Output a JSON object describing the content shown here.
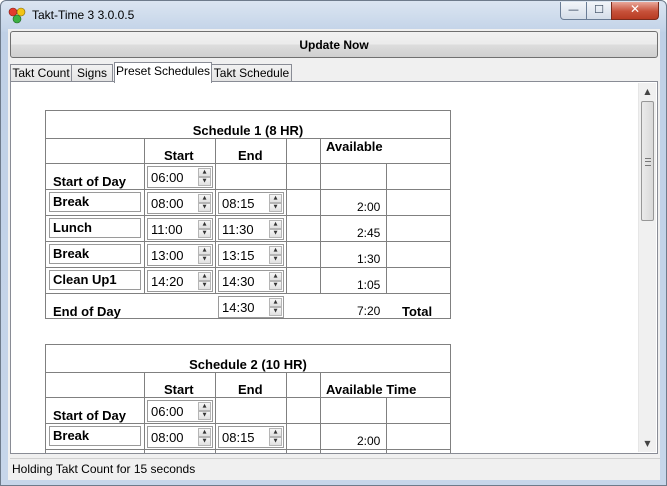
{
  "window": {
    "title": "Takt-Time 3  3.0.0.5",
    "controls": {
      "minimize_glyph": "—",
      "maximize_glyph": "☐",
      "close_glyph": "✕"
    }
  },
  "toolbar": {
    "update_label": "Update Now"
  },
  "tabs": [
    {
      "label": "Takt Count",
      "active": false
    },
    {
      "label": "Signs",
      "active": false
    },
    {
      "label": "Preset Schedules",
      "active": true
    },
    {
      "label": "Takt Schedule",
      "active": false
    }
  ],
  "scrollbar": {
    "up_glyph": "▲",
    "down_glyph": "▼"
  },
  "schedules": [
    {
      "title": "Schedule 1 (8 HR)",
      "headers": {
        "start": "Start",
        "end": "End",
        "available": "Available"
      },
      "start_of_day": {
        "label": "Start of Day",
        "start": "06:00"
      },
      "rows": [
        {
          "name": "Break",
          "start": "08:00",
          "end": "08:15",
          "available": "2:00"
        },
        {
          "name": "Lunch",
          "start": "11:00",
          "end": "11:30",
          "available": "2:45"
        },
        {
          "name": "Break",
          "start": "13:00",
          "end": "13:15",
          "available": "1:30"
        },
        {
          "name": "Clean Up1",
          "start": "14:20",
          "end": "14:30",
          "available": "1:05"
        }
      ],
      "end_of_day": {
        "label": "End of Day",
        "end": "14:30",
        "available": "7:20",
        "total_label": "Total"
      }
    },
    {
      "title": "Schedule 2 (10 HR)",
      "headers": {
        "start": "Start",
        "end": "End",
        "available": "Available Time"
      },
      "start_of_day": {
        "label": "Start of Day",
        "start": "06:00"
      },
      "rows": [
        {
          "name": "Break",
          "start": "08:00",
          "end": "08:15",
          "available": "2:00"
        }
      ]
    }
  ],
  "status_bar": {
    "text": "Holding Takt Count for 15 seconds"
  }
}
